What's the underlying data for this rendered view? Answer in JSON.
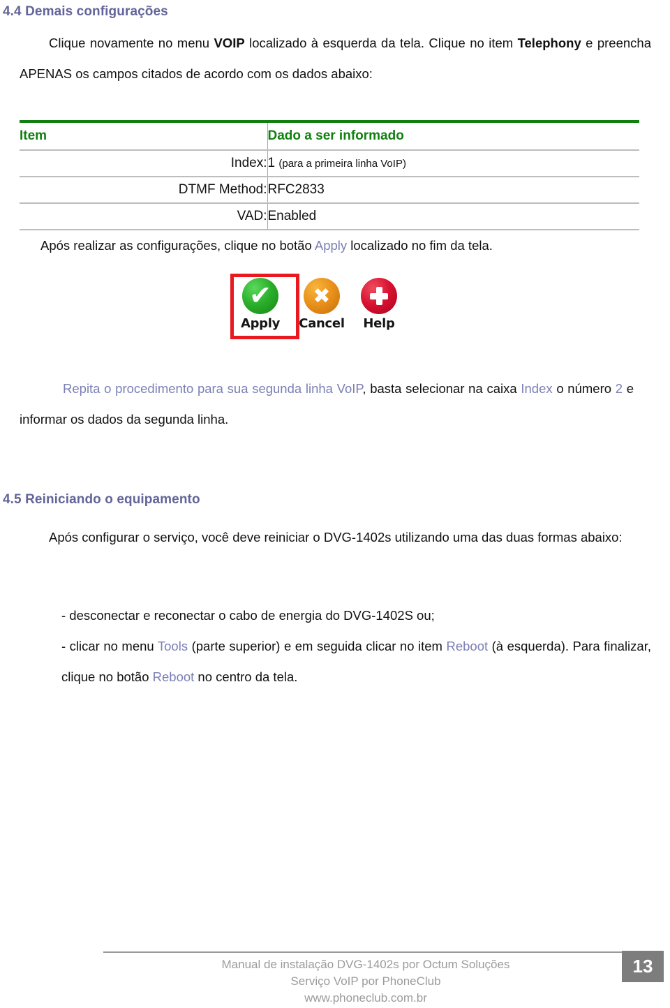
{
  "document": {
    "section_4_4": {
      "heading": "4.4 Demais configurações",
      "intro": {
        "p1": "Clique novamente no menu ",
        "menu_name": "VOIP",
        "p2": " localizado à esquerda da tela. Clique no item ",
        "item_name": "Telephony",
        "p3": " e preencha APENAS os campos citados de acordo com os dados abaixo:"
      },
      "table": {
        "headers": [
          "Item",
          "Dado a ser informado"
        ],
        "rows": [
          {
            "item": "Index:",
            "value": "1",
            "note": "(para a primeira linha VoIP)"
          },
          {
            "item": "DTMF Method:",
            "value": "RFC2833",
            "note": ""
          },
          {
            "item": "VAD:",
            "value": "Enabled",
            "note": ""
          }
        ]
      },
      "apply_paragraph": {
        "p1": "Após realizar as configurações, clique no botão ",
        "link": "Apply",
        "p2": " localizado no fim da tela."
      },
      "button_bar": {
        "buttons": [
          {
            "label": "Apply",
            "icon": "green-check-icon",
            "highlighted": "true"
          },
          {
            "label": "Cancel",
            "icon": "orange-x-icon",
            "highlighted": "false"
          },
          {
            "label": "Help",
            "icon": "red-plus-icon",
            "highlighted": "false"
          }
        ]
      },
      "repeat_paragraph": {
        "p1": "Repita o procedimento para sua segunda linha VoIP",
        "p2": ", basta selecionar na caixa ",
        "p3": "Index",
        "p4": " o número ",
        "p5": "2",
        "p6": " e informar os dados da segunda linha."
      }
    },
    "section_4_5": {
      "heading": "4.5 Reiniciando o equipamento",
      "intro": "Após configurar o serviço, você deve reiniciar o DVG-1402s utilizando uma das duas formas abaixo:",
      "bullets": {
        "b1": "- desconectar e reconectar o cabo de energia do DVG-1402S ou;",
        "b2_p1": "- clicar no menu ",
        "b2_menu": "Tools",
        "b2_p2": " (parte superior) e em seguida clicar no item ",
        "b2_item": "Reboot",
        "b2_p3": " (à esquerda). Para finalizar, clique no botão ",
        "b2_button": "Reboot",
        "b2_p4": " no centro da tela."
      }
    },
    "footer": {
      "line1": "Manual de instalação DVG-1402s por Octum Soluções",
      "line2": "Serviço VoIP por PhoneClub",
      "line3": "www.phoneclub.com.br",
      "page_number": "13"
    },
    "colors": {
      "heading": "#636499",
      "accent_link": "#7b7fb5",
      "table_header_green": "#108010",
      "highlight_red": "#e8191f",
      "footer_gray": "#9b9b9b",
      "page_box_gray": "#7d7d7d"
    }
  }
}
